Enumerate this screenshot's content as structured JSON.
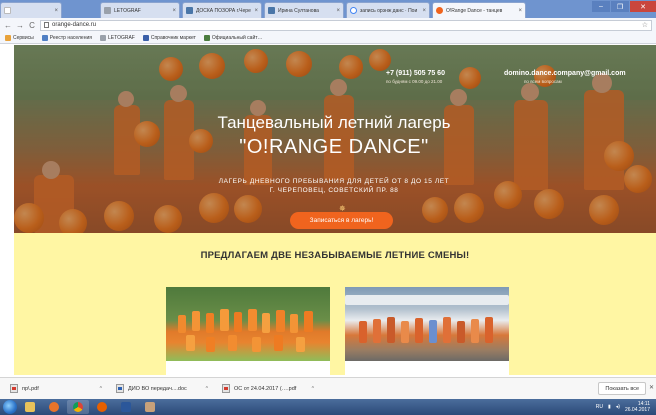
{
  "browser": {
    "tabs": [
      {
        "title": "",
        "active": false
      },
      {
        "title": "LETOGRAF",
        "active": false
      },
      {
        "title": "ДОСКА ПОЗОРА г.Черепо",
        "active": false
      },
      {
        "title": "Ирина Султанова",
        "active": false
      },
      {
        "title": "запись орэнж данс · Пои",
        "active": false
      },
      {
        "title": "O!Range Dance - танцев",
        "active": true
      }
    ],
    "window_controls": {
      "minimize": "–",
      "maximize": "❐",
      "close": "✕"
    },
    "address": {
      "url": "orange-dance.ru",
      "back": "←",
      "forward": "→",
      "reload": "C",
      "star": "☆"
    },
    "bookmarks": [
      {
        "label": "Сервисы",
        "color": "#e8a23b"
      },
      {
        "label": "Реестр населения",
        "color": "#4f7fc4"
      },
      {
        "label": "LETOGRAF",
        "color": "#9aa1ab"
      },
      {
        "label": "Справочник маркет",
        "color": "#3a5fa8"
      },
      {
        "label": "Официальный сайт…",
        "color": "#4b7c3f"
      }
    ]
  },
  "site": {
    "phone": "+7 (911) 505 75 60",
    "phone_sub": "по будням с 09.00 до 21.00",
    "email": "domino.dance.company@gmail.com",
    "email_sub": "по всем вопросам",
    "title_line": "Танцевальный летний лагерь",
    "brand": "\"O!RANGE DANCE\"",
    "subtitle1": "ЛАГЕРЬ ДНЕВНОГО ПРЕБЫВАНИЯ ДЛЯ ДЕТЕЙ ОТ 8 ДО 15 ЛЕТ",
    "subtitle2": "Г. ЧЕРЕПОВЕЦ, СОВЕТСКИЙ ПР. 88",
    "cta_label": "Записаться в лагерь!",
    "section_title": "ПРЕДЛАГАЕМ ДВЕ НЕЗАБЫВАЕМЫЕ ЛЕТНИЕ СМЕНЫ!",
    "accent_color": "#f0641e",
    "section_bg": "#fff6a3"
  },
  "downloads": {
    "items": [
      {
        "name": "пр\\.pdf",
        "type": "pdf"
      },
      {
        "name": "ДИО ВО передач....doc",
        "type": "doc"
      },
      {
        "name": "ОС от 24.04.2017 (….pdf",
        "type": "pdf"
      }
    ],
    "show_all": "Показать все",
    "close": "✕"
  },
  "taskbar": {
    "lang": "RU",
    "time": "14:11",
    "date": "26.04.2017"
  }
}
